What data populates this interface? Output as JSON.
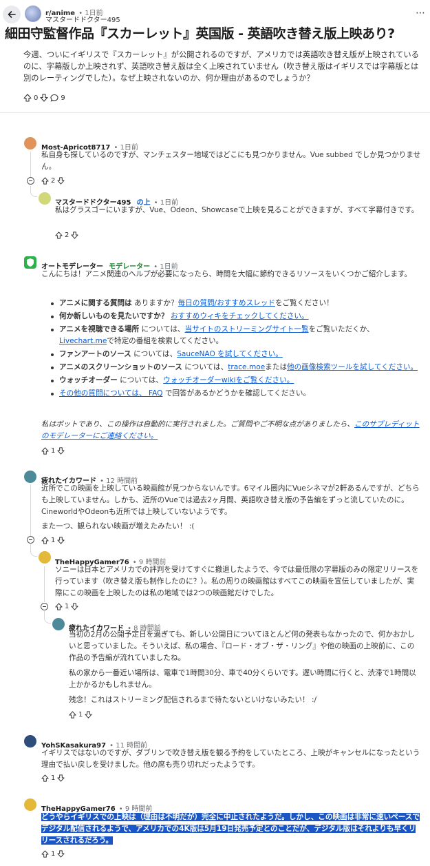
{
  "header": {
    "subreddit": "r/anime",
    "time": "1日前",
    "poster": "マスタードドクター495",
    "more": "⋯"
  },
  "post": {
    "title": "細田守監督作品『スカーレット』英国版 - 英語吹き替え版上映あり?",
    "body": "今週、ついにイギリスで『スカーレット』が公開されるのですが、アメリカでは英語吹き替え版が上映されているのに、字幕版しか上映されず、英語吹き替え版は全く上映されていません（吹き替え版はイギリスでは字幕版とは別のレーティングでした）。なぜ上映されないのか、何か理由があるのでしょうか？",
    "votes": "0",
    "comments": "9"
  },
  "comments": [
    {
      "author": "Most-Apricot8717",
      "time": "1日前",
      "avatar_color": "#e0935a",
      "text": "私自身も探しているのですが、マンチェスター地域ではどこにも見つかりません。Vue subbed でしか見つかりません。",
      "votes": "2"
    },
    {
      "author": "マスタードドクター495",
      "op_tag": "の上",
      "time": "1日前",
      "text": "私はグラスゴーにいますが、Vue、Odeon、Showcaseで上映を見ることができますが、すべて字幕付きです。",
      "votes": "2"
    },
    {
      "author": "オートモデレーター",
      "mod_tag": "モデレーター",
      "time": "1日前",
      "intro": "こんにちは！アニメ関連のヘルプが必要になったら、時間を大幅に節約できるリソースをいくつかご紹介します。",
      "items": [
        {
          "bold": "アニメに関する質問は",
          "pre": " ありますか？",
          "link": "毎日の質問/おすすめスレッド",
          "post": "をご覧ください！"
        },
        {
          "bold": "何か新しいものを見たいですか？",
          "pre": " ",
          "link": "おすすめウィキをチェックしてください。",
          "post": ""
        },
        {
          "bold": "アニメを視聴できる場所",
          "pre": " については、",
          "link": "当サイトのストリーミングサイト一覧",
          "post": "をご覧いただくか、",
          "link2": "Livechart.me",
          "post2": "で特定の番組を検索してください。"
        },
        {
          "bold": "ファンアートのソース",
          "pre": " については、",
          "link": "SauceNAO を試してください。",
          "post": ""
        },
        {
          "bold": "アニメのスクリーンショットのソース",
          "pre": " については、",
          "link": "trace.moe",
          "post": "または",
          "link2": "他の画像検索ツールを試してください。",
          "post2": ""
        },
        {
          "bold": "ウォッチオーダー",
          "pre": " については、",
          "link": "ウォッチオーダーwikiをご覧ください。",
          "post": ""
        },
        {
          "bold": "",
          "pre": "",
          "link": "その他の質問については、 FAQ",
          "post": " で回答があるかどうかを確認してください。"
        }
      ],
      "footer_text": "私はボットであり、この操作は自動的に実行されました。ご質問やご不明な点がありましたら、",
      "footer_link": "このサブレディットのモデレーターにご連絡ください。",
      "votes": "1"
    },
    {
      "author": "疲れたイカワード",
      "time": "12 時間前",
      "text": "近所でこの映画を上映している映画館が見つからないんです。6マイル圏内にVueシネマが2軒あるんですが、どちらも上映していません。しかも、近所のVueでは過去2ヶ月間、英語吹き替え版の予告編をずっと流していたのに。CineworldやOdeonも近所では上映していないようです。",
      "text2": "また一つ、観られない映画が増えたみたい！ :(",
      "votes": "1"
    },
    {
      "author": "TheHappyGamer76",
      "time": "9 時間前",
      "text": "ソニーは日本とアメリカでの評判を受けてすぐに撤退したようで、今では最低限の字幕版のみの限定リリースを行っています（吹き替え版も制作したのに？）。私の周りの映画館はすべてこの映画を宣伝していましたが、実際にこの映画を上映したのは私の地域では2つの映画館だけでした。",
      "votes": "1"
    },
    {
      "author": "疲れたイカワード",
      "time": "8 時間前",
      "text": "当初の2月の公開予定日を過ぎても、新しい公開日についてほとんど何の発表もなかったので、何かおかしいと思っていました。そういえば、私の場合、『ロード・オブ・ザ・リング』や他の映画の上映前に、この作品の予告編が流れていましたね。",
      "text2": "私の家から一番近い場所は、電車で1時間30分、車で40分くらいです。遅い時間に行くと、渋滞で1時間以上かかるかもしれません。",
      "text3": "残念！これはストリーミング配信されるまで待たないといけないみたい！ :/",
      "votes": "1"
    },
    {
      "author": "YohSKasakura97",
      "time": "11 時間前",
      "text": "イギリスではないのですが、ダブリンで吹き替え版を観る予約をしていたところ、上映がキャンセルになったという理由で払い戻しを受けました。他の席も売り切れだったようです。",
      "votes": "1"
    },
    {
      "author": "TheHappyGamer76",
      "time": "9 時間前",
      "text": "どうやらイギリスでの上映は（理由は不明だが）完全に中止されたようだ。しかし、この映画は非常に速いペースでデジタル配信されるようで、アメリカでの4K版は5月19日発売予定とのことだが、デジタル版はそれよりも早くリリースされるだろう。",
      "votes": "1"
    }
  ],
  "colors": {
    "link": "#0a5bd3",
    "mod_green": "#1a8a2c",
    "selection": "#1a56c6"
  },
  "icons": {
    "back": "arrow-left-icon",
    "upvote": "arrow-up-icon",
    "downvote": "arrow-down-icon",
    "comment": "speech-bubble-icon",
    "collapse": "minus-circle-icon",
    "more": "ellipsis-icon"
  }
}
